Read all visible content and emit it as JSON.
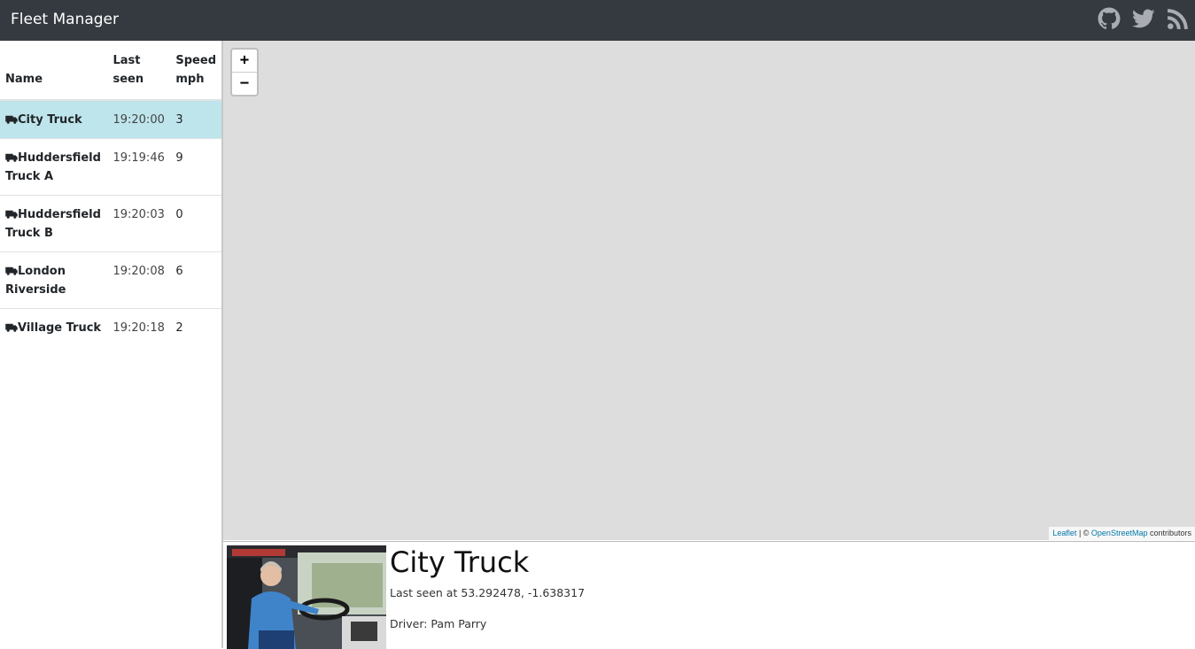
{
  "app": {
    "title": "Fleet Manager"
  },
  "nav": {
    "icons": [
      "github-icon",
      "twitter-icon",
      "rss-icon"
    ]
  },
  "table": {
    "headers": {
      "name": "Name",
      "last_seen": "Last seen",
      "speed": "Speed mph"
    },
    "rows": [
      {
        "name": "City Truck",
        "last_seen": "19:20:00",
        "speed": "3",
        "selected": true
      },
      {
        "name": "Huddersfield Truck A",
        "last_seen": "19:19:46",
        "speed": "9",
        "selected": false
      },
      {
        "name": "Huddersfield Truck B",
        "last_seen": "19:20:03",
        "speed": "0",
        "selected": false
      },
      {
        "name": "London Riverside",
        "last_seen": "19:20:08",
        "speed": "6",
        "selected": false
      },
      {
        "name": "Village Truck",
        "last_seen": "19:20:18",
        "speed": "2",
        "selected": false
      }
    ]
  },
  "map": {
    "zoom_in": "+",
    "zoom_out": "−",
    "attribution": {
      "leaflet": "Leaflet",
      "separator": " | © ",
      "osm": "OpenStreetMap",
      "suffix": " contributors"
    }
  },
  "detail": {
    "title": "City Truck",
    "last_seen": "Last seen at 53.292478, -1.638317",
    "driver": "Driver: Pam Parry"
  },
  "colors": {
    "navbar": "#343a40",
    "selected_row": "#bee5eb",
    "map_background": "#dddddd",
    "link": "#0078a8"
  }
}
